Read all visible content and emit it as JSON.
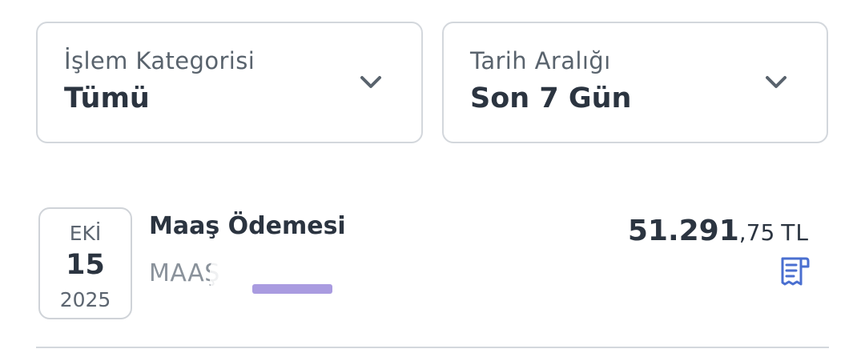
{
  "filters": {
    "category": {
      "label": "İşlem Kategorisi",
      "value": "Tümü"
    },
    "date_range": {
      "label": "Tarih Aralığı",
      "value": "Son 7 Gün"
    }
  },
  "transaction": {
    "date": {
      "month": "EKİ",
      "day": "15",
      "year": "2025"
    },
    "title": "Maaş Ödemesi",
    "subtitle": "MAAŞ",
    "amount_main": "51.291",
    "amount_decimal": ",75",
    "currency": "TL",
    "receipt_icon": "receipt-icon"
  },
  "colors": {
    "text_primary": "#2b3440",
    "text_secondary": "#8a929b",
    "border": "#d3d7dc",
    "accent": "#4a6fd0"
  }
}
